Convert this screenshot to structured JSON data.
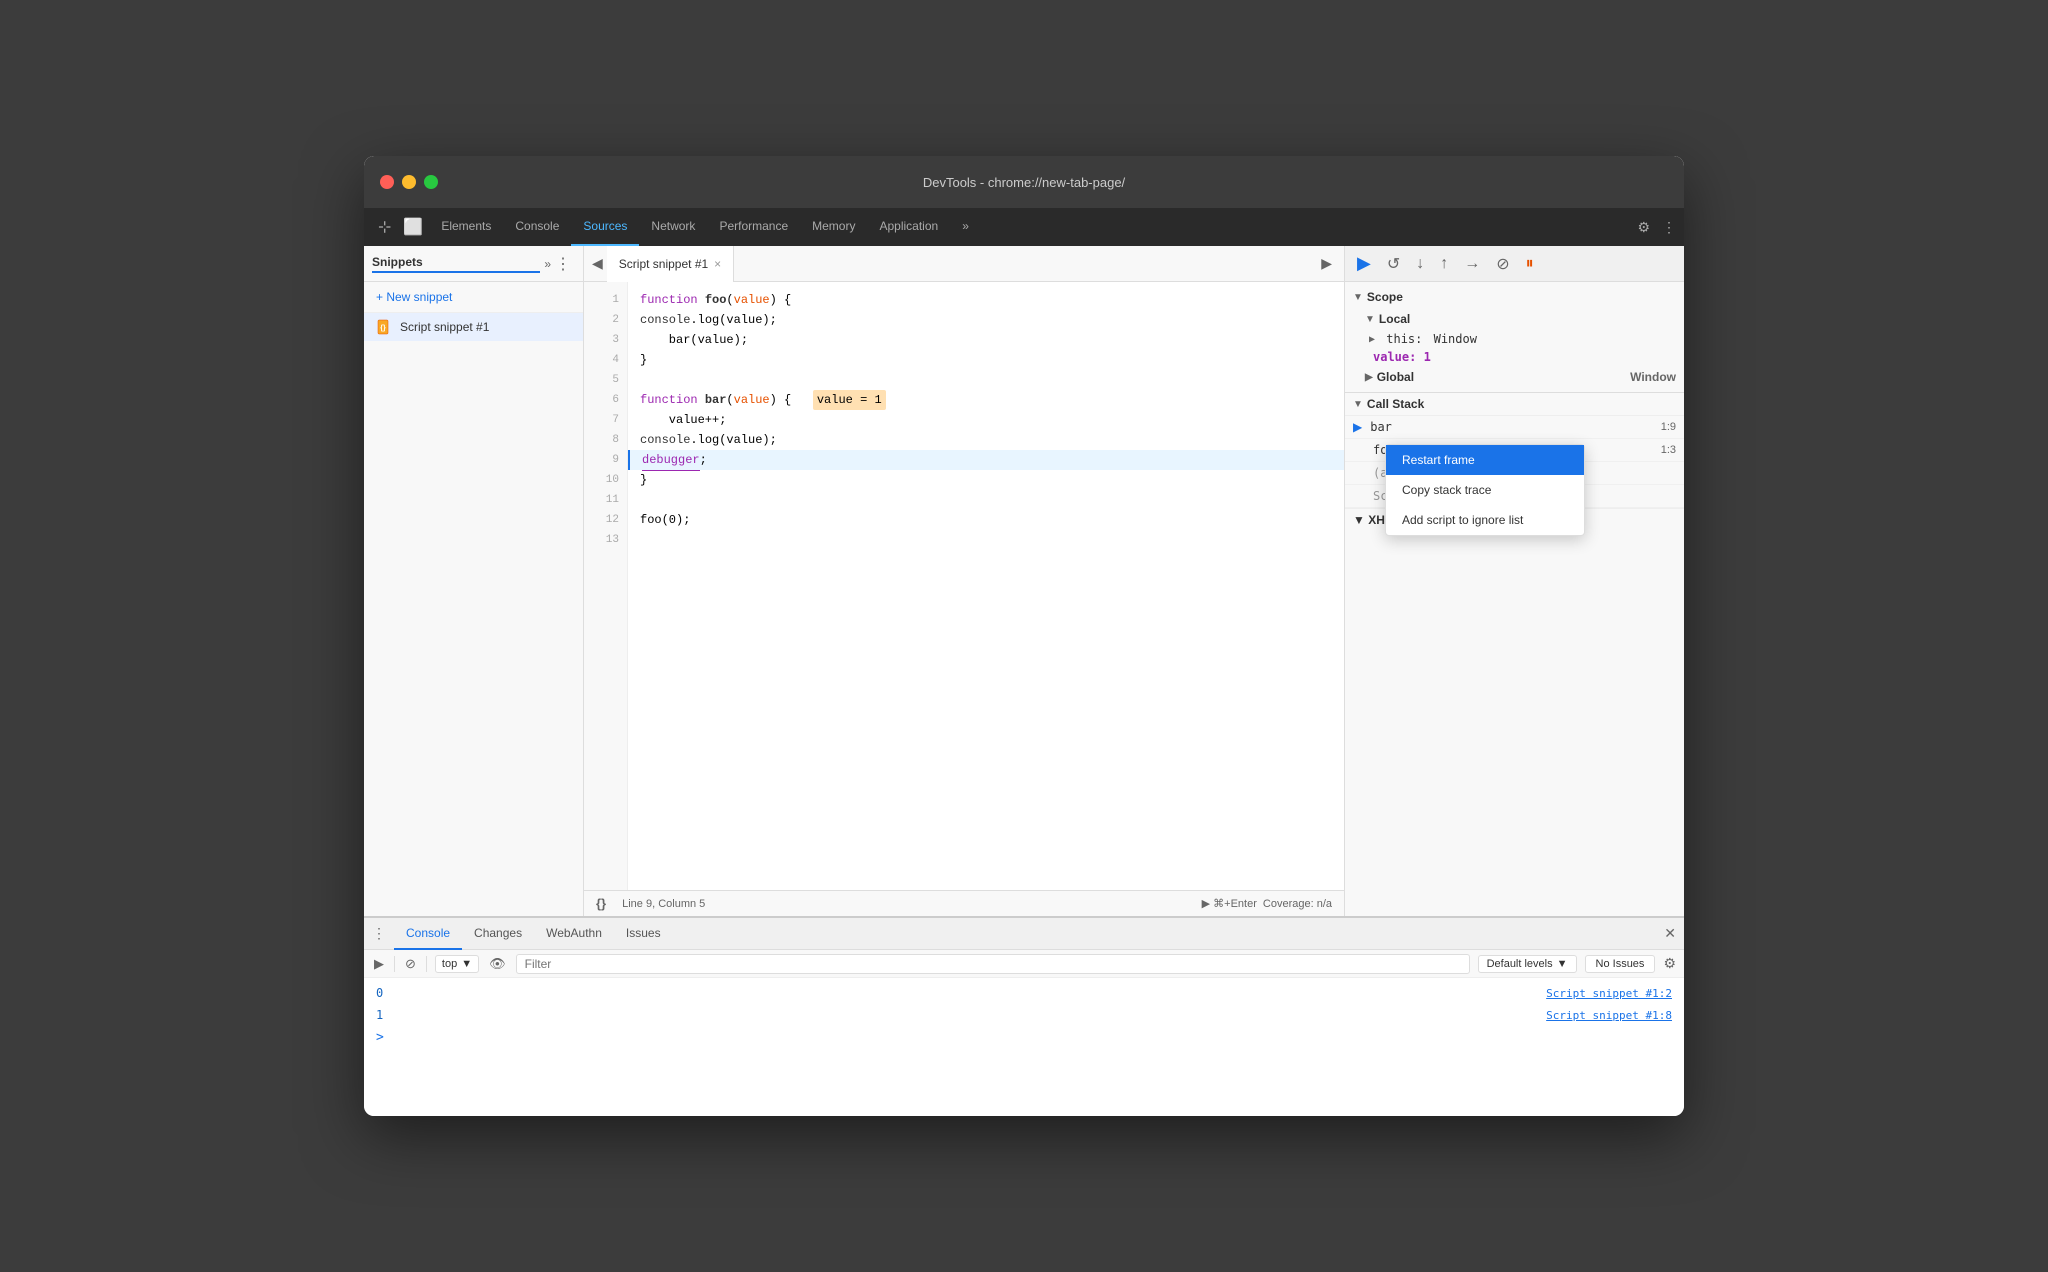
{
  "window": {
    "title": "DevTools - chrome://new-tab-page/",
    "controls": {
      "close": "●",
      "minimize": "●",
      "maximize": "●"
    }
  },
  "main_tabs": {
    "items": [
      {
        "label": "Elements",
        "active": false
      },
      {
        "label": "Console",
        "active": false
      },
      {
        "label": "Sources",
        "active": true
      },
      {
        "label": "Network",
        "active": false
      },
      {
        "label": "Performance",
        "active": false
      },
      {
        "label": "Memory",
        "active": false
      },
      {
        "label": "Application",
        "active": false
      }
    ],
    "more": "»",
    "settings_icon": "⚙",
    "kebab_icon": "⋮"
  },
  "sidebar": {
    "title": "Snippets",
    "chevron": "»",
    "new_snippet_label": "+ New snippet",
    "snippet_name": "Script snippet #1"
  },
  "editor": {
    "tab_label": "Script snippet #1",
    "tab_close": "×",
    "nav_back": "◀",
    "run_btn": "▶",
    "code_lines": [
      {
        "num": 1,
        "text": "function foo(value) {"
      },
      {
        "num": 2,
        "text": "    console.log(value);"
      },
      {
        "num": 3,
        "text": "    bar(value);"
      },
      {
        "num": 4,
        "text": "}"
      },
      {
        "num": 5,
        "text": ""
      },
      {
        "num": 6,
        "text": "function bar(value) {   value = 1"
      },
      {
        "num": 7,
        "text": "    value++;"
      },
      {
        "num": 8,
        "text": "    console.log(value);"
      },
      {
        "num": 9,
        "text": "    debugger;",
        "debugger_line": true
      },
      {
        "num": 10,
        "text": "}"
      },
      {
        "num": 11,
        "text": ""
      },
      {
        "num": 12,
        "text": "foo(0);"
      },
      {
        "num": 13,
        "text": ""
      }
    ],
    "status": {
      "format_icon": "{}",
      "location": "Line 9, Column 5",
      "run_label": "▶  ⌘+Enter",
      "coverage": "Coverage: n/a"
    }
  },
  "right_panel": {
    "toolbar": {
      "resume": "▶",
      "step_over": "↺",
      "step_into": "↓",
      "step_out": "↑",
      "step": "→",
      "deactivate": "⊘",
      "pause_on_exceptions": "⏸"
    },
    "scope": {
      "title": "Scope",
      "local": {
        "title": "Local",
        "items": [
          {
            "key": "▶ this:",
            "value": "Window"
          },
          {
            "key": "value:",
            "value": "1"
          }
        ]
      },
      "global": {
        "title": "Global",
        "value": "Window"
      }
    },
    "callstack": {
      "title": "Call Stack",
      "items": [
        {
          "name": "bar",
          "loc": "1:9",
          "active": true
        },
        {
          "name": "foo",
          "loc": "1:3"
        },
        {
          "name": "(anonymous)",
          "loc": ""
        },
        {
          "sublabel": "Script snippet #1:12"
        }
      ]
    },
    "context_menu": {
      "items": [
        {
          "label": "Restart frame",
          "active": true
        },
        {
          "label": "Copy stack trace",
          "active": false
        },
        {
          "label": "Add script to ignore list",
          "active": false
        }
      ]
    },
    "xhrfetch": "▼ XHR/fetch Breakpoints"
  },
  "bottom_panel": {
    "tabs": [
      {
        "label": "Console",
        "active": true
      },
      {
        "label": "Changes",
        "active": false
      },
      {
        "label": "WebAuthn",
        "active": false
      },
      {
        "label": "Issues",
        "active": false
      }
    ],
    "toolbar": {
      "run_icon": "▶",
      "block_icon": "⊘",
      "context": "top",
      "context_arrow": "▼",
      "eye_icon": "👁",
      "filter_placeholder": "Filter",
      "levels_label": "Default levels",
      "levels_arrow": "▼",
      "issues_label": "No Issues",
      "settings_icon": "⚙"
    },
    "output": [
      {
        "value": "0",
        "source": "Script snippet #1:2"
      },
      {
        "value": "1",
        "source": "Script snippet #1:8"
      }
    ],
    "prompt": ">"
  }
}
